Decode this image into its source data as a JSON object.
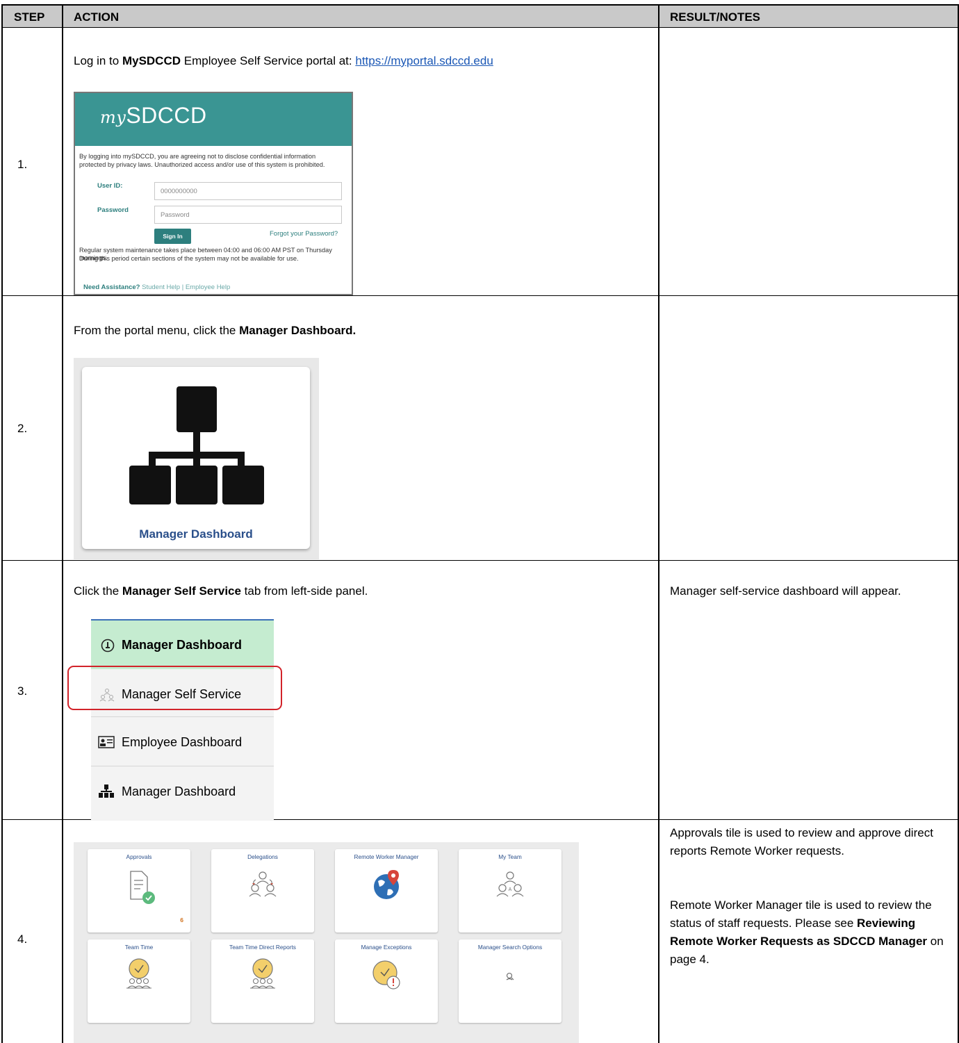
{
  "header": {
    "step": "STEP",
    "action": "ACTION",
    "result": "RESULT/NOTES"
  },
  "rows": [
    {
      "step": "1.",
      "action_pre": "Log in to ",
      "action_bold": "MySDCCD",
      "action_mid": " Employee Self Service portal at: ",
      "action_link": "https://myportal.sdccd.edu",
      "notes": ""
    },
    {
      "step": "2.",
      "action_pre": "From the portal menu, click the ",
      "action_bold": "Manager Dashboard.",
      "notes": ""
    },
    {
      "step": "3.",
      "action_pre": "Click the ",
      "action_bold": "Manager Self Service",
      "action_post": " tab from left-side panel.",
      "notes": "Manager self-service dashboard will appear."
    },
    {
      "step": "4.",
      "notes_p1": "Approvals tile is used to review and approve direct reports Remote Worker requests.",
      "notes_p2_pre": "Remote Worker Manager tile is used to review the status of staff requests. Please see ",
      "notes_p2_bold": "Reviewing Remote Worker Requests as SDCCD Manager",
      "notes_p2_post": " on page 4."
    }
  ],
  "login": {
    "logo_my": "my",
    "logo_rest": "SDCCD",
    "disclaimer1": "By logging into mySDCCD, you are agreeing not to disclose confidential information",
    "disclaimer2": "protected by privacy laws. Unauthorized access and/or use of this system is prohibited.",
    "userid_label": "User ID:",
    "userid_value": "0000000000",
    "password_label": "Password",
    "password_placeholder": "Password",
    "signin": "Sign In",
    "forgot": "Forgot your Password?",
    "maint1": "Regular system maintenance takes place between 04:00 and 06:00 AM PST on Thursday mornings.",
    "maint2": "During this period certain sections of the system may not be available for use.",
    "assist_label": "Need Assistance?",
    "assist_links": " Student Help | Employee Help",
    "brand_color": "#3a9593"
  },
  "manager_tile": {
    "label": "Manager Dashboard"
  },
  "nav": {
    "items": [
      {
        "label": "Manager Dashboard",
        "icon": "dashboard-gauge-icon",
        "selected": true
      },
      {
        "label": "Manager Self Service",
        "icon": "team-people-icon",
        "selected": false
      },
      {
        "label": "Employee Dashboard",
        "icon": "id-card-icon",
        "selected": false
      },
      {
        "label": "Manager Dashboard",
        "icon": "org-chart-icon",
        "selected": false
      }
    ]
  },
  "tiles": [
    {
      "title": "Approvals",
      "icon": "document-check-icon",
      "badge": "6"
    },
    {
      "title": "Delegations",
      "icon": "delegation-people-icon"
    },
    {
      "title": "Remote Worker Manager",
      "icon": "globe-location-icon"
    },
    {
      "title": "My Team",
      "icon": "team-people-icon"
    },
    {
      "title": "Team Time",
      "icon": "clock-people-icon"
    },
    {
      "title": "Team Time Direct Reports",
      "icon": "clock-people-icon"
    },
    {
      "title": "Manage Exceptions",
      "icon": "clock-alert-icon"
    },
    {
      "title": "Manager Search Options",
      "icon": "search-person-icon"
    }
  ]
}
